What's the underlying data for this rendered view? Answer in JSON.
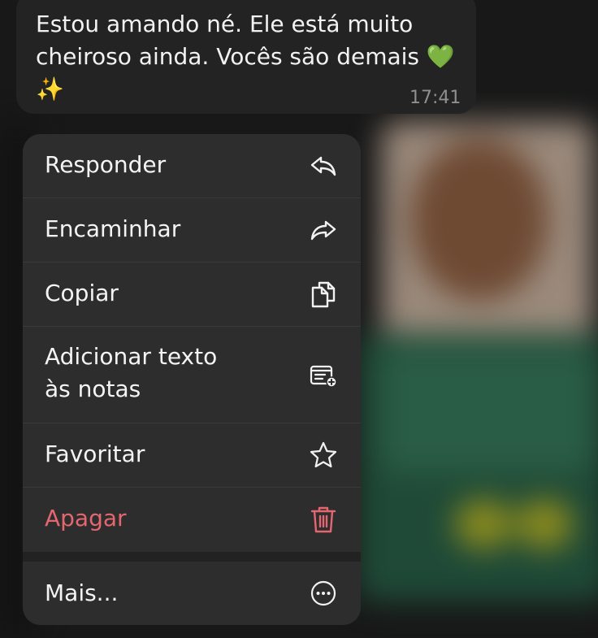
{
  "message": {
    "lines": [
      "Estou amando né. Ele está muito",
      "cheiroso ainda. Vocês são demais 💚",
      "✨"
    ],
    "time": "17:41"
  },
  "menu": {
    "items": [
      {
        "label": "Responder",
        "icon": "reply-icon"
      },
      {
        "label": "Encaminhar",
        "icon": "forward-icon"
      },
      {
        "label": "Copiar",
        "icon": "copy-icon"
      },
      {
        "label_lines": [
          "Adicionar texto",
          "às notas"
        ],
        "icon": "add-to-notes-icon"
      },
      {
        "label": "Favoritar",
        "icon": "star-icon"
      },
      {
        "label": "Apagar",
        "icon": "trash-icon"
      },
      {
        "label": "Mais...",
        "icon": "more-icon"
      }
    ]
  },
  "colors": {
    "danger": "#e4676f",
    "menu_background": "#2d2d2d",
    "bubble_background": "#232323"
  }
}
